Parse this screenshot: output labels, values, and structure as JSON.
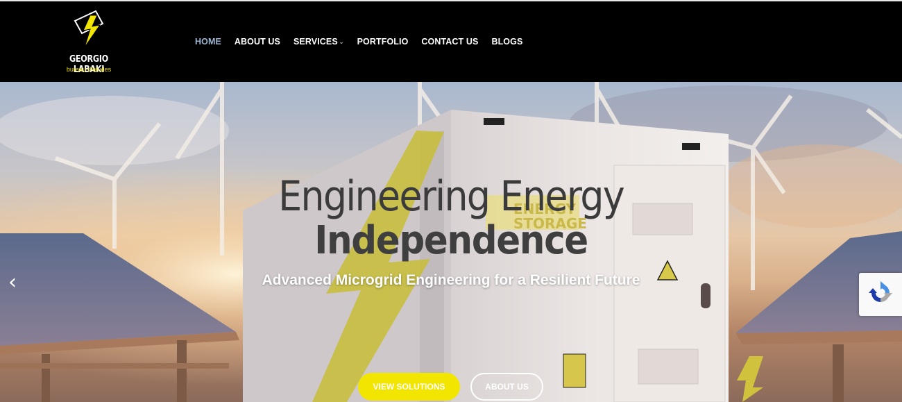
{
  "brand": {
    "name": "GEORGIO LABAKI",
    "subtitle": "bureau d'études",
    "accent_color": "#f2e500"
  },
  "nav": {
    "items": [
      {
        "label": "HOME",
        "active": true
      },
      {
        "label": "ABOUT US",
        "active": false
      },
      {
        "label": "SERVICES",
        "active": false,
        "has_dropdown": true
      },
      {
        "label": "PORTFOLIO",
        "active": false
      },
      {
        "label": "CONTACT US",
        "active": false
      },
      {
        "label": "BLOGS",
        "active": false
      }
    ]
  },
  "hero": {
    "headline_line1": "Engineering Energy",
    "headline_line2": "Independence",
    "tagline": "Advanced Microgrid Engineering for a Resilient Future",
    "primary_button": "VIEW SOLUTIONS",
    "secondary_button": "ABOUT US",
    "container_sign_line1": "ENERGY",
    "container_sign_line2": "STORAGE",
    "prev_icon": "chevron-left-icon",
    "next_icon": "chevron-right-icon"
  },
  "widgets": {
    "recaptcha_icon": "recaptcha-icon"
  }
}
